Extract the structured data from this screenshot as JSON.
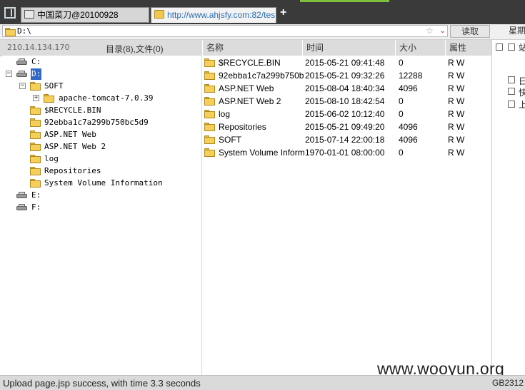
{
  "tabs": [
    {
      "label": "中国菜刀@20100928"
    },
    {
      "label": "http://www.ahjsfy.com:82/tes..."
    }
  ],
  "new_tab_label": "+",
  "address": {
    "value": "D:\\",
    "star": "☆",
    "read_button": "读取",
    "week_label": "星期"
  },
  "header": {
    "ip": "210.14.134.170",
    "counts": "目录(8),文件(0)"
  },
  "columns": {
    "name": "名称",
    "time": "时间",
    "size": "大小",
    "attr": "属性"
  },
  "tree": [
    {
      "label": "C:",
      "kind": "drive"
    },
    {
      "label": "D:",
      "kind": "drive",
      "selected": true
    },
    {
      "label": "SOFT",
      "kind": "folder"
    },
    {
      "label": "apache-tomcat-7.0.39",
      "kind": "folder"
    },
    {
      "label": "$RECYCLE.BIN",
      "kind": "folder"
    },
    {
      "label": "92ebba1c7a299b750bc5d9",
      "kind": "folder"
    },
    {
      "label": "ASP.NET Web",
      "kind": "folder"
    },
    {
      "label": "ASP.NET Web 2",
      "kind": "folder"
    },
    {
      "label": "log",
      "kind": "folder"
    },
    {
      "label": "Repositories",
      "kind": "folder"
    },
    {
      "label": "System Volume Information",
      "kind": "folder"
    },
    {
      "label": "E:",
      "kind": "drive"
    },
    {
      "label": "F:",
      "kind": "drive"
    }
  ],
  "files": [
    {
      "name": "$RECYCLE.BIN",
      "time": "2015-05-21 09:41:48",
      "size": "0",
      "attr": "R W"
    },
    {
      "name": "92ebba1c7a299b750b...",
      "time": "2015-05-21 09:32:26",
      "size": "12288",
      "attr": "R W"
    },
    {
      "name": "ASP.NET Web",
      "time": "2015-08-04 18:40:34",
      "size": "4096",
      "attr": "R W"
    },
    {
      "name": "ASP.NET Web 2",
      "time": "2015-08-10 18:42:54",
      "size": "0",
      "attr": "R W"
    },
    {
      "name": "log",
      "time": "2015-06-02 10:12:40",
      "size": "0",
      "attr": "R W"
    },
    {
      "name": "Repositories",
      "time": "2015-05-21 09:49:20",
      "size": "4096",
      "attr": "R W"
    },
    {
      "name": "SOFT",
      "time": "2015-07-14 22:00:18",
      "size": "4096",
      "attr": "R W"
    },
    {
      "name": "System Volume Inform...",
      "time": "1970-01-01 08:00:00",
      "size": "0",
      "attr": "R W"
    }
  ],
  "right_panel": {
    "chars": [
      "站",
      "日",
      "快",
      "上"
    ]
  },
  "status": {
    "text": "Upload page.jsp success, with time 3.3 seconds",
    "encoding": "GB2312"
  },
  "watermark": "www.wooyun.org",
  "colors": {
    "selection": "#3169c6",
    "tab_link": "#2a6fb5",
    "folder": "#f5cf5a",
    "status_bar": "#dadada"
  }
}
